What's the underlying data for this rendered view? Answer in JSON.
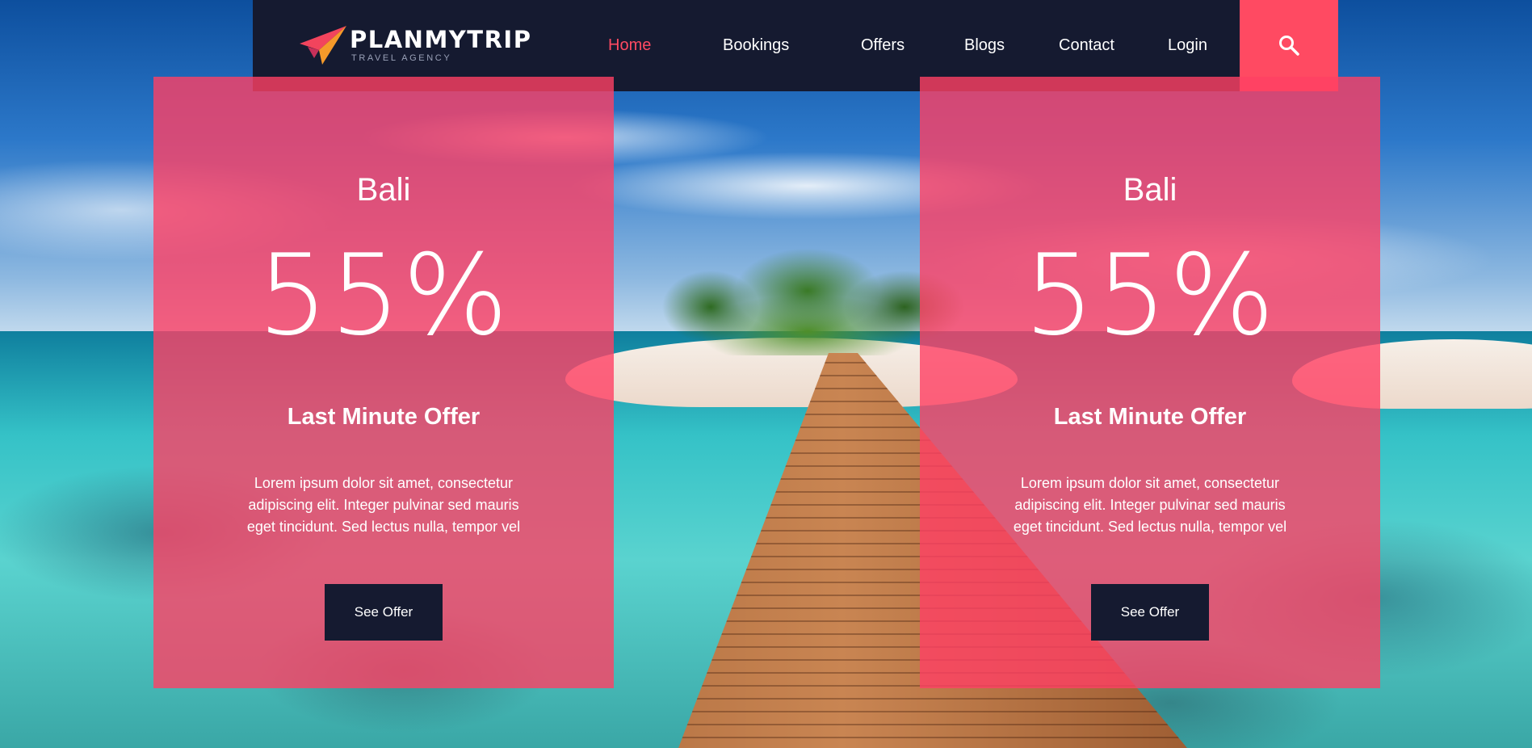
{
  "brand": {
    "name": "PLANMYTRIP",
    "tagline": "TRAVEL AGENCY"
  },
  "nav": {
    "items": [
      {
        "label": "Home",
        "active": true
      },
      {
        "label": "Bookings",
        "active": false
      },
      {
        "label": "Offers",
        "active": false
      },
      {
        "label": "Blogs",
        "active": false
      },
      {
        "label": "Contact",
        "active": false
      },
      {
        "label": "Login",
        "active": false
      }
    ],
    "search_icon": "search-icon"
  },
  "offers": [
    {
      "destination": "Bali",
      "discount": "55%",
      "title": "Last Minute Offer",
      "description": "Lorem ipsum dolor sit amet, consectetur adipiscing elit. Integer pulvinar sed mauris eget tincidunt. Sed lectus nulla, tempor vel",
      "button": "See Offer"
    },
    {
      "destination": "Bali",
      "discount": "55%",
      "title": "Last Minute Offer",
      "description": "Lorem ipsum dolor sit amet, consectetur adipiscing elit. Integer pulvinar sed mauris eget tincidunt. Sed lectus nulla, tempor vel",
      "button": "See Offer"
    }
  ],
  "colors": {
    "navbar": "#151a30",
    "accent": "#ff4a62",
    "card_overlay": "#ff4064",
    "button": "#151a30"
  }
}
